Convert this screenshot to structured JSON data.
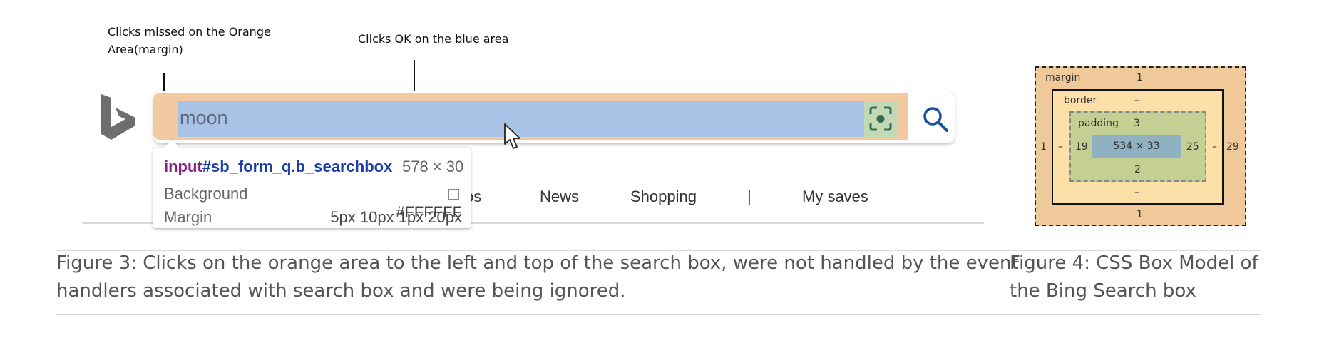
{
  "annotations": {
    "margin_note_line1": "Clicks missed on the Orange",
    "margin_note_line2": "Area(margin)",
    "blue_note": "Clicks OK on the blue area"
  },
  "search": {
    "query": "moon"
  },
  "tooltip": {
    "tag": "input",
    "id": "#sb_form_q.b_searchbox",
    "size": "578 × 30",
    "rows": [
      {
        "label": "Background",
        "value": "#FFFFFF"
      },
      {
        "label": "Margin",
        "value": "5px 10px 1px 20px"
      }
    ]
  },
  "nav": {
    "partial_item": "ps",
    "items": [
      "News",
      "Shopping",
      "|",
      "My saves"
    ]
  },
  "box_model": {
    "margin_label": "margin",
    "border_label": "border",
    "padding_label": "padding",
    "content": "534 × 33",
    "margin": {
      "top": "1",
      "right": "29",
      "bottom": "1",
      "left": "1"
    },
    "border": {
      "top": "–",
      "right": "–",
      "bottom": "–",
      "left": "–"
    },
    "padding": {
      "top": "3",
      "right": "25",
      "bottom": "2",
      "left": "19"
    }
  },
  "captions": {
    "fig3_line1": "Figure 3: Clicks on the orange area to the left and top of the  search box, were not handled by the event",
    "fig3_line2": "handlers associated with search box and were being ignored.",
    "fig4_line1": "Figure 4: CSS Box Model of",
    "fig4_line2": "the Bing Search box"
  },
  "colors": {
    "margin_orange": "#f3c9a2",
    "input_blue": "#a9c3e6",
    "padding_green": "#c3cf93",
    "border_yellow": "#fde0a8",
    "content_blue": "#8fb1c2"
  }
}
